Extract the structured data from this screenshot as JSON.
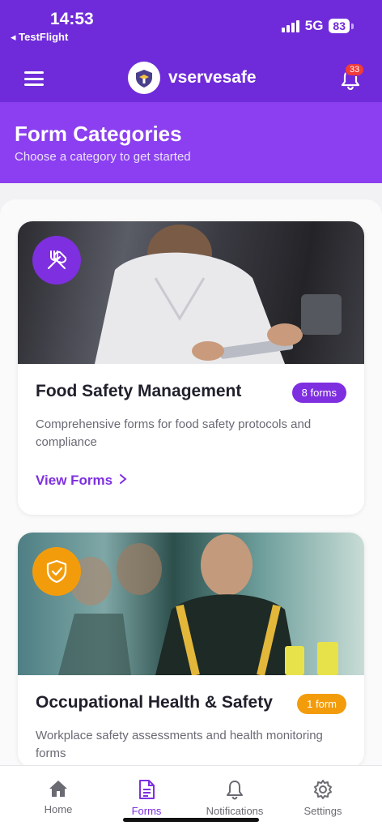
{
  "status": {
    "time": "14:53",
    "back_app": "◂ TestFlight",
    "network": "5G",
    "battery": "83"
  },
  "header": {
    "brand": "vservesafe",
    "notification_count": "33"
  },
  "page": {
    "title": "Form Categories",
    "subtitle": "Choose a category to get started"
  },
  "categories": [
    {
      "title": "Food Safety Management",
      "badge": "8 forms",
      "description": "Comprehensive forms for food safety protocols and compliance",
      "link": "View Forms",
      "icon": "utensils-icon",
      "accent": "#7e2fe0"
    },
    {
      "title": "Occupational Health & Safety",
      "badge": "1 form",
      "description": "Workplace safety assessments and health monitoring forms",
      "icon": "shield-check-icon",
      "accent": "#f39c0b"
    }
  ],
  "tabs": [
    {
      "label": "Home",
      "icon": "home-icon"
    },
    {
      "label": "Forms",
      "icon": "document-icon",
      "active": true
    },
    {
      "label": "Notifications",
      "icon": "bell-icon"
    },
    {
      "label": "Settings",
      "icon": "gear-icon"
    }
  ],
  "colors": {
    "primary": "#6f2bd9",
    "header_band": "#8b3ff0",
    "accent_orange": "#f39c0b",
    "badge_red": "#ef3b3b"
  }
}
